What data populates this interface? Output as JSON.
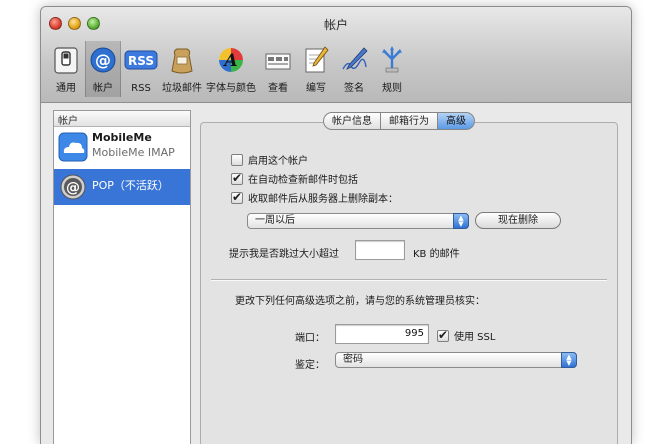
{
  "window": {
    "title": "帐户"
  },
  "toolbar": {
    "items": [
      {
        "label": "通用",
        "icon": "general-switch-icon"
      },
      {
        "label": "帐户",
        "icon": "at-sign-icon"
      },
      {
        "label": "RSS",
        "icon": "rss-icon"
      },
      {
        "label": "垃圾邮件",
        "icon": "junk-mail-bag-icon"
      },
      {
        "label": "字体与颜色",
        "icon": "fonts-colors-icon"
      },
      {
        "label": "查看",
        "icon": "viewing-icon"
      },
      {
        "label": "编写",
        "icon": "composing-icon"
      },
      {
        "label": "签名",
        "icon": "signature-pen-icon"
      },
      {
        "label": "规则",
        "icon": "rules-icon"
      }
    ],
    "rss_text": "RSS",
    "selected": "帐户"
  },
  "accounts": {
    "header": "帐户",
    "items": [
      {
        "name": "MobileMe",
        "subtitle": "MobileMe IMAP",
        "icon": "mobileme-cloud-icon"
      },
      {
        "name": "POP（不活跃）",
        "icon": "pop-at-sign-icon",
        "selected": true
      }
    ]
  },
  "tabs": [
    {
      "label": "帐户信息"
    },
    {
      "label": "邮箱行为"
    },
    {
      "label": "高级",
      "active": true
    }
  ],
  "advanced": {
    "enable_account": {
      "label": "启用这个帐户",
      "checked": false
    },
    "include_in_auto_check": {
      "label": "在自动检查新邮件时包括",
      "checked": true
    },
    "remove_copy": {
      "label": "收取邮件后从服务器上删除副本：",
      "checked": true
    },
    "remove_after_popup": {
      "value": "一周以后"
    },
    "remove_now_button": "现在删除",
    "prompt_size_label": "提示我是否跳过大小超过",
    "prompt_size_value": "",
    "prompt_size_unit": "KB 的邮件",
    "notice": "更改下列任何高级选项之前，请与您的系统管理员核实：",
    "port_label": "端口：",
    "port_value": "995",
    "use_ssl": {
      "label": "使用 SSL",
      "checked": true
    },
    "auth_label": "鉴定：",
    "auth_value": "密码"
  },
  "colors": {
    "accent": "#3875d7",
    "tab_active": "#5b9ae6"
  }
}
